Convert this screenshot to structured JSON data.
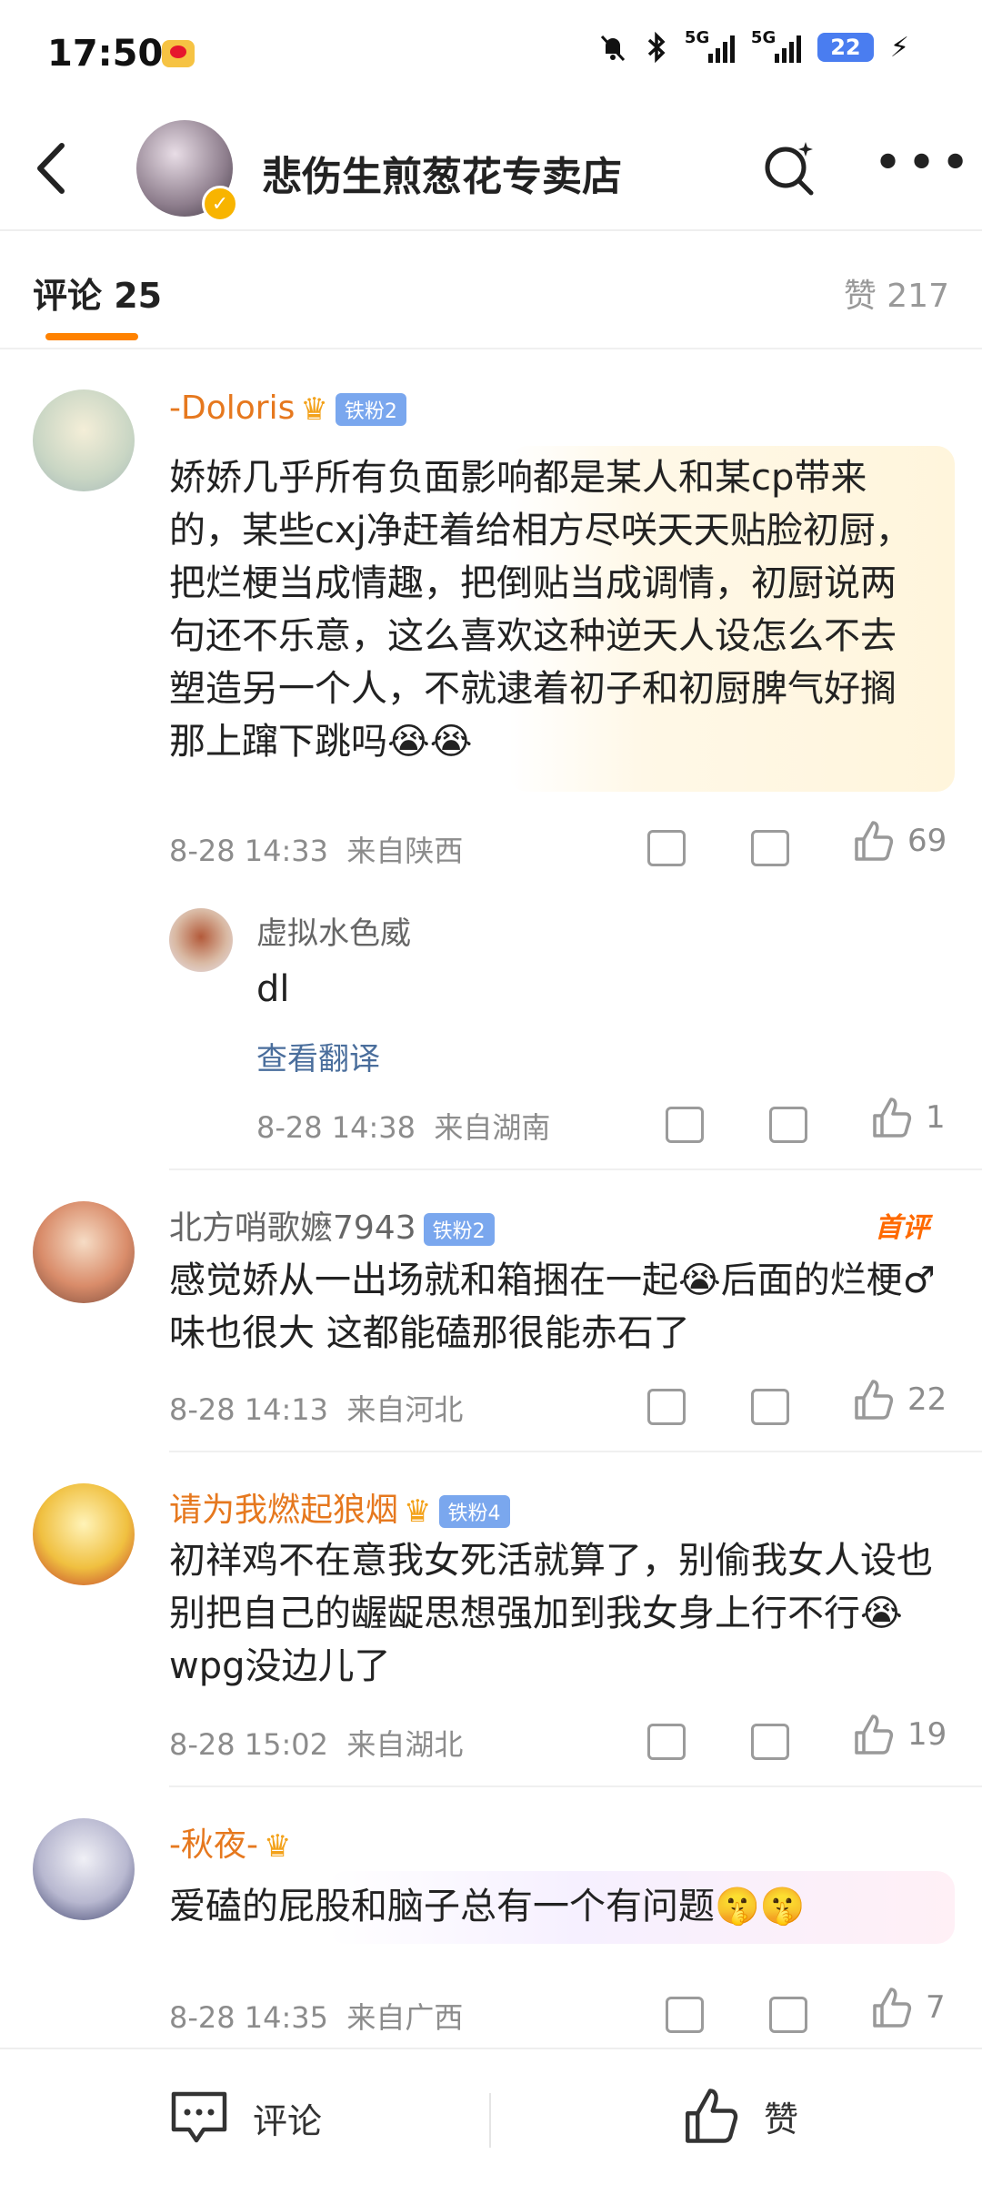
{
  "status_bar": {
    "time": "17:50",
    "app_icon": "weibo-icon",
    "icons": [
      "mute-bell-icon",
      "bluetooth-icon",
      "signal-5g-icon",
      "signal-5g-icon"
    ],
    "battery": "22"
  },
  "header": {
    "title": "悲伤生煎葱花专卖店",
    "back_icon": "back-arrow-icon",
    "search_icon": "sparkle-search-icon",
    "more_icon": "more-dots-icon"
  },
  "tabs": {
    "comments_label": "评论 25",
    "likes_label": "赞 217",
    "accent_color": "#ff8200"
  },
  "comments": [
    {
      "user": "-Doloris",
      "badge": "铁粉2",
      "text": "娇娇几乎所有负面影响都是某人和某cp带来的，某些cxj净赶着给相方尽咲天天贴脸初厨，把烂梗当成情趣，把倒贴当成调情，初厨说两句还不乐意，这么喜欢这种逆天人设怎么不去塑造另一个人，不就逮着初子和初厨脾气好搁那上蹿下跳吗😭😭",
      "time": "8-28 14:33",
      "location": "来自陕西",
      "likes": "69",
      "reply": {
        "user": "虚拟水色威",
        "text": "dl",
        "translate": "查看翻译",
        "time": "8-28 14:38",
        "location": "来自湖南",
        "likes": "1"
      }
    },
    {
      "user": "北方哨歌嬷7943",
      "badge": "铁粉2",
      "tag": "首评",
      "text": "感觉娇从一出场就和箱捆在一起😭后面的烂梗♂味也很大 这都能磕那很能赤石了",
      "time": "8-28 14:13",
      "location": "来自河北",
      "likes": "22"
    },
    {
      "user": "请为我燃起狼烟",
      "badge": "铁粉4",
      "text": "初祥鸡不在意我女死活就算了，别偷我女人设也别把自己的龌龊思想强加到我女身上行不行😭wpg没边儿了",
      "time": "8-28 15:02",
      "location": "来自湖北",
      "likes": "19"
    },
    {
      "user": "-秋夜-",
      "text": "爱磕的屁股和脑子总有一个有问题🤫🤫",
      "time": "8-28 14:35",
      "location": "来自广西",
      "likes": "7"
    }
  ],
  "bottom_bar": {
    "comment_label": "评论",
    "like_label": "赞"
  },
  "colors": {
    "username_highlight": "#e6781e",
    "badge_blue": "#7aa7ee",
    "translate_link": "#4a6e9c"
  }
}
